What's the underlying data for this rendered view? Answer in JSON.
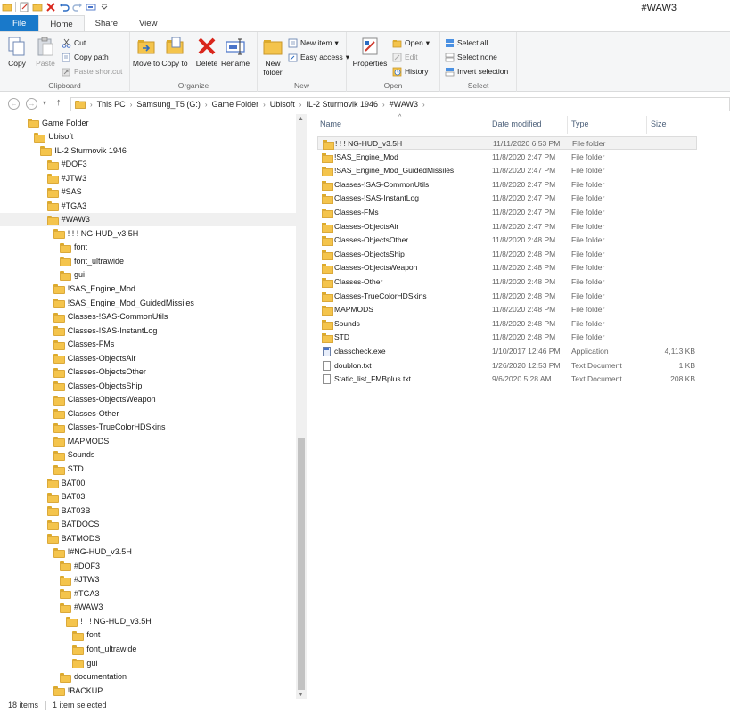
{
  "window": {
    "title": "#WAW3"
  },
  "ribbon_tabs": [
    "File",
    "Home",
    "Share",
    "View"
  ],
  "ribbon": {
    "clipboard": {
      "label": "Clipboard",
      "copy": "Copy",
      "paste": "Paste",
      "cut": "Cut",
      "copy_path": "Copy path",
      "paste_shortcut": "Paste shortcut"
    },
    "organize": {
      "label": "Organize",
      "move_to": "Move to",
      "copy_to": "Copy to",
      "delete": "Delete",
      "rename": "Rename"
    },
    "new": {
      "label": "New",
      "new_folder": "New folder",
      "new_item": "New item",
      "easy_access": "Easy access"
    },
    "open": {
      "label": "Open",
      "properties": "Properties",
      "open": "Open",
      "edit": "Edit",
      "history": "History"
    },
    "select": {
      "label": "Select",
      "select_all": "Select all",
      "select_none": "Select none",
      "invert_selection": "Invert selection"
    }
  },
  "address": {
    "crumbs": [
      "This PC",
      "Samsung_T5 (G:)",
      "Game Folder",
      "Ubisoft",
      "IL-2 Sturmovik 1946",
      "#WAW3"
    ]
  },
  "tree": [
    {
      "label": "Game Folder",
      "level": 0
    },
    {
      "label": "Ubisoft",
      "level": 1
    },
    {
      "label": "IL-2 Sturmovik 1946",
      "level": 2
    },
    {
      "label": "#DOF3",
      "level": 3
    },
    {
      "label": "#JTW3",
      "level": 3
    },
    {
      "label": "#SAS",
      "level": 3
    },
    {
      "label": "#TGA3",
      "level": 3
    },
    {
      "label": "#WAW3",
      "level": 3,
      "selected": true
    },
    {
      "label": "! ! ! NG-HUD_v3.5H",
      "level": 4
    },
    {
      "label": "font",
      "level": 5
    },
    {
      "label": "font_ultrawide",
      "level": 5
    },
    {
      "label": "gui",
      "level": 5
    },
    {
      "label": "!SAS_Engine_Mod",
      "level": 4
    },
    {
      "label": "!SAS_Engine_Mod_GuidedMissiles",
      "level": 4
    },
    {
      "label": "Classes-!SAS-CommonUtils",
      "level": 4
    },
    {
      "label": "Classes-!SAS-InstantLog",
      "level": 4
    },
    {
      "label": "Classes-FMs",
      "level": 4
    },
    {
      "label": "Classes-ObjectsAir",
      "level": 4
    },
    {
      "label": "Classes-ObjectsOther",
      "level": 4
    },
    {
      "label": "Classes-ObjectsShip",
      "level": 4
    },
    {
      "label": "Classes-ObjectsWeapon",
      "level": 4
    },
    {
      "label": "Classes-Other",
      "level": 4
    },
    {
      "label": "Classes-TrueColorHDSkins",
      "level": 4
    },
    {
      "label": "MAPMODS",
      "level": 4
    },
    {
      "label": "Sounds",
      "level": 4
    },
    {
      "label": "STD",
      "level": 4
    },
    {
      "label": "BAT00",
      "level": 3
    },
    {
      "label": "BAT03",
      "level": 3
    },
    {
      "label": "BAT03B",
      "level": 3
    },
    {
      "label": "BATDOCS",
      "level": 3
    },
    {
      "label": "BATMODS",
      "level": 3
    },
    {
      "label": "!#NG-HUD_v3.5H",
      "level": 4
    },
    {
      "label": "#DOF3",
      "level": 5
    },
    {
      "label": "#JTW3",
      "level": 5
    },
    {
      "label": "#TGA3",
      "level": 5
    },
    {
      "label": "#WAW3",
      "level": 5
    },
    {
      "label": "! ! ! NG-HUD_v3.5H",
      "level": 6
    },
    {
      "label": "font",
      "level": 7
    },
    {
      "label": "font_ultrawide",
      "level": 7
    },
    {
      "label": "gui",
      "level": 7
    },
    {
      "label": "documentation",
      "level": 5
    },
    {
      "label": "!BACKUP",
      "level": 4
    }
  ],
  "columns": {
    "name": "Name",
    "date": "Date modified",
    "type": "Type",
    "size": "Size"
  },
  "files": [
    {
      "name": "! ! ! NG-HUD_v3.5H",
      "date": "11/11/2020 6:53 PM",
      "type": "File folder",
      "size": "",
      "kind": "folder",
      "selected": true
    },
    {
      "name": "!SAS_Engine_Mod",
      "date": "11/8/2020 2:47 PM",
      "type": "File folder",
      "size": "",
      "kind": "folder"
    },
    {
      "name": "!SAS_Engine_Mod_GuidedMissiles",
      "date": "11/8/2020 2:47 PM",
      "type": "File folder",
      "size": "",
      "kind": "folder"
    },
    {
      "name": "Classes-!SAS-CommonUtils",
      "date": "11/8/2020 2:47 PM",
      "type": "File folder",
      "size": "",
      "kind": "folder"
    },
    {
      "name": "Classes-!SAS-InstantLog",
      "date": "11/8/2020 2:47 PM",
      "type": "File folder",
      "size": "",
      "kind": "folder"
    },
    {
      "name": "Classes-FMs",
      "date": "11/8/2020 2:47 PM",
      "type": "File folder",
      "size": "",
      "kind": "folder"
    },
    {
      "name": "Classes-ObjectsAir",
      "date": "11/8/2020 2:47 PM",
      "type": "File folder",
      "size": "",
      "kind": "folder"
    },
    {
      "name": "Classes-ObjectsOther",
      "date": "11/8/2020 2:48 PM",
      "type": "File folder",
      "size": "",
      "kind": "folder"
    },
    {
      "name": "Classes-ObjectsShip",
      "date": "11/8/2020 2:48 PM",
      "type": "File folder",
      "size": "",
      "kind": "folder"
    },
    {
      "name": "Classes-ObjectsWeapon",
      "date": "11/8/2020 2:48 PM",
      "type": "File folder",
      "size": "",
      "kind": "folder"
    },
    {
      "name": "Classes-Other",
      "date": "11/8/2020 2:48 PM",
      "type": "File folder",
      "size": "",
      "kind": "folder"
    },
    {
      "name": "Classes-TrueColorHDSkins",
      "date": "11/8/2020 2:48 PM",
      "type": "File folder",
      "size": "",
      "kind": "folder"
    },
    {
      "name": "MAPMODS",
      "date": "11/8/2020 2:48 PM",
      "type": "File folder",
      "size": "",
      "kind": "folder"
    },
    {
      "name": "Sounds",
      "date": "11/8/2020 2:48 PM",
      "type": "File folder",
      "size": "",
      "kind": "folder"
    },
    {
      "name": "STD",
      "date": "11/8/2020 2:48 PM",
      "type": "File folder",
      "size": "",
      "kind": "folder"
    },
    {
      "name": "classcheck.exe",
      "date": "1/10/2017 12:46 PM",
      "type": "Application",
      "size": "4,113 KB",
      "kind": "exe"
    },
    {
      "name": "doublon.txt",
      "date": "1/26/2020 12:53 PM",
      "type": "Text Document",
      "size": "1 KB",
      "kind": "txt"
    },
    {
      "name": "Static_list_FMBplus.txt",
      "date": "9/6/2020 5:28 AM",
      "type": "Text Document",
      "size": "208 KB",
      "kind": "txt"
    }
  ],
  "status": {
    "item_count": "18 items",
    "selection": "1 item selected"
  },
  "colors": {
    "file_tab": "#1979ca",
    "folder": "#f4c44c",
    "delete_x": "#d9261c"
  }
}
